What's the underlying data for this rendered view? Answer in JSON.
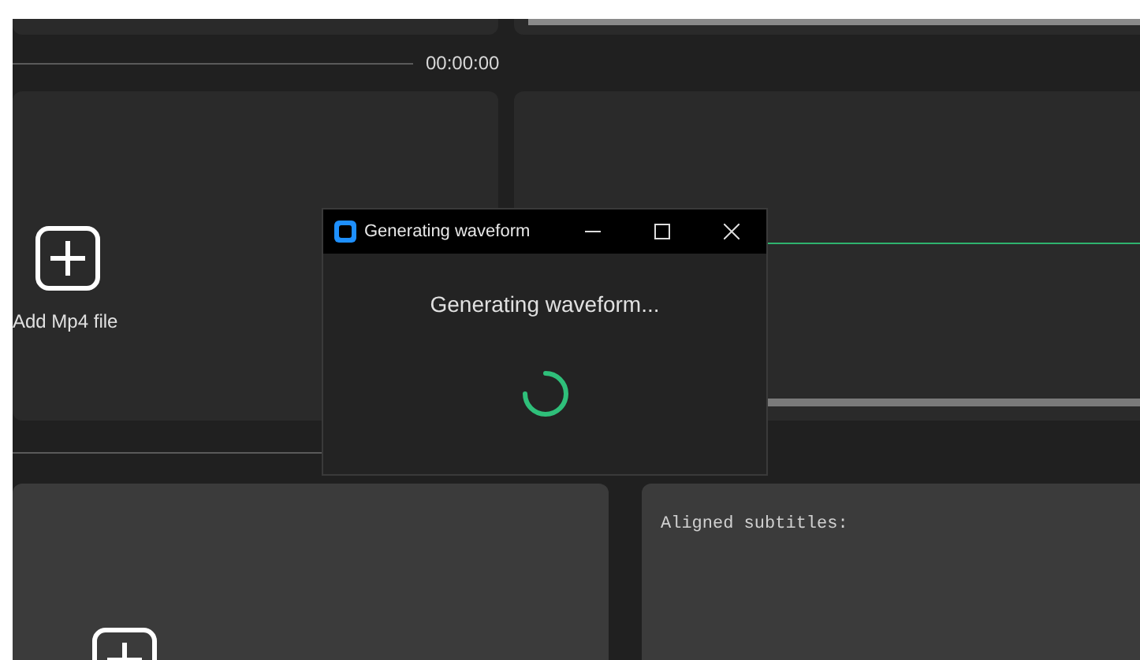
{
  "timeline": {
    "time": "00:00:00"
  },
  "video_panel": {
    "label": "Add Mp4 file"
  },
  "subtitles_panel": {
    "label": "Aligned subtitles:"
  },
  "dialog": {
    "title": "Generating waveform",
    "message": "Generating waveform..."
  }
}
